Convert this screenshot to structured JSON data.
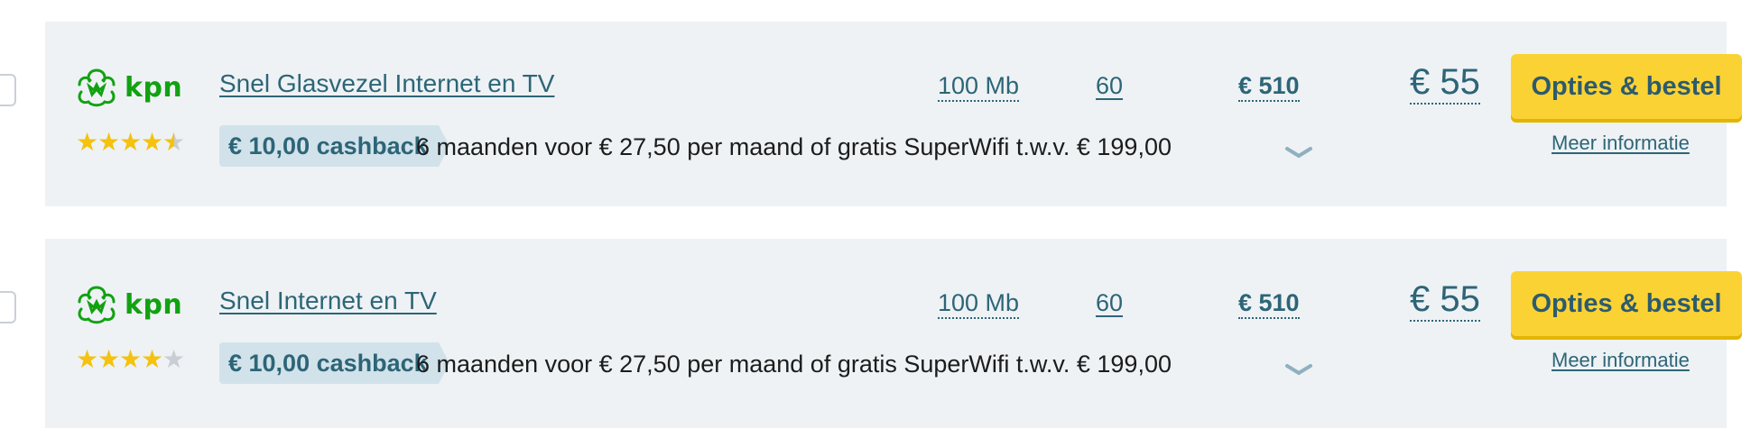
{
  "offers": [
    {
      "logo_text": "kpn",
      "rating": 4.5,
      "product_name": "Snel Glasvezel Internet en TV",
      "speed": "100 Mb",
      "channels": "60",
      "total_cost": "€ 510",
      "monthly_price": "€ 55",
      "cta_label": "Opties & bestel",
      "more_info": "Meer informatie",
      "cashback": "€ 10,00 cashback",
      "promo_text": "6 maanden voor € 27,50 per maand of gratis SuperWifi t.w.v. € 199,00"
    },
    {
      "logo_text": "kpn",
      "rating": 4,
      "product_name": "Snel Internet en TV",
      "speed": "100 Mb",
      "channels": "60",
      "total_cost": "€ 510",
      "monthly_price": "€ 55",
      "cta_label": "Opties & bestel",
      "more_info": "Meer informatie",
      "cashback": "€ 10,00 cashback",
      "promo_text": "6 maanden voor € 27,50 per maand of gratis SuperWifi t.w.v. € 199,00"
    }
  ],
  "colors": {
    "brand_green": "#11a211",
    "star_gold": "#f4c20f",
    "cta_yellow": "#fbd234",
    "link_teal": "#2d6577",
    "card_bg": "#eef2f5"
  }
}
